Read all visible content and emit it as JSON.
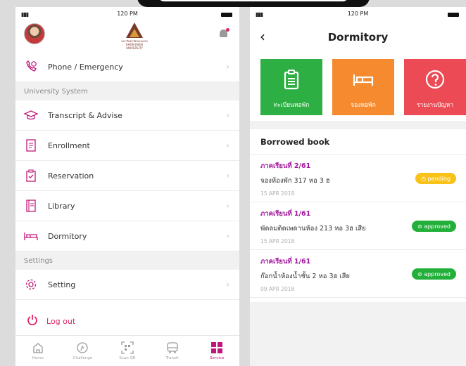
{
  "status_bar": {
    "time": "120 PM"
  },
  "left_screen": {
    "menu_top": [
      {
        "label": "Phone / Emergency",
        "icon": "phone-icon"
      }
    ],
    "sections": [
      {
        "title": "University System",
        "items": [
          {
            "label": "Transcript & Advise",
            "icon": "graduation-cap-icon"
          },
          {
            "label": "Enrollment",
            "icon": "document-icon"
          },
          {
            "label": "Reservation",
            "icon": "clipboard-check-icon"
          },
          {
            "label": "Library",
            "icon": "book-icon"
          },
          {
            "label": "Dormitory",
            "icon": "bed-icon"
          }
        ]
      },
      {
        "title": "Settings",
        "items": [
          {
            "label": "Setting",
            "icon": "gear-icon"
          }
        ]
      }
    ],
    "logout_label": "Log out",
    "tabs": [
      {
        "label": "Home",
        "icon": "home-icon",
        "active": false
      },
      {
        "label": "Challenge",
        "icon": "challenge-icon",
        "active": false
      },
      {
        "label": "Scan QR",
        "icon": "qr-icon",
        "active": false
      },
      {
        "label": "Transit",
        "icon": "bus-icon",
        "active": false
      },
      {
        "label": "Service",
        "icon": "grid-icon",
        "active": true
      }
    ]
  },
  "right_screen": {
    "title": "Dormitory",
    "tiles": [
      {
        "label": "ทะเบียนหอพัก",
        "icon": "clipboard-icon",
        "color": "#2eaf43"
      },
      {
        "label": "จองหอพัก",
        "icon": "bed-icon",
        "color": "#f58b2e"
      },
      {
        "label": "รายงานปัญหา",
        "icon": "question-icon",
        "color": "#ec4b55"
      }
    ],
    "borrowed_heading": "Borrowed book",
    "entries": [
      {
        "term": "ภาคเรียนที่ 2/61",
        "desc": "จองห้องพัก 317 หอ 3 ฮ",
        "date": "15 APR 2018",
        "status": "pending",
        "status_label": "pending"
      },
      {
        "term": "ภาคเรียนที่ 1/61",
        "desc": "พัดลมติดเพดานห้อง 213 หอ 3ฮ เสีย",
        "date": "15 APR 2018",
        "status": "approved",
        "status_label": "approved"
      },
      {
        "term": "ภาคเรียนที่ 1/61",
        "desc": "ก๊อกน้ำห้องน้ำชั้น 2 หอ 3ฮ เสีย",
        "date": "09 APR 2018",
        "status": "approved",
        "status_label": "approved"
      }
    ]
  },
  "colors": {
    "accent": "#c0187a",
    "term": "#a0169a",
    "logout": "#e0245e"
  }
}
